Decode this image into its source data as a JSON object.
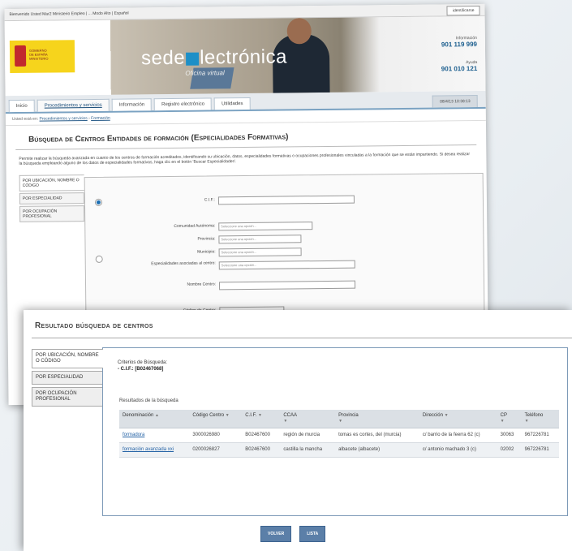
{
  "back": {
    "topbar": "Bienvenido Usted Mar2 Ministerio Empleo | ... Modo Alto | Español",
    "account": "identificarse",
    "logo_left": "sede",
    "logo_right": "lectrónica",
    "logo_sub": "Oficina virtual",
    "phone1_label": "Información",
    "phone1": "901 119 999",
    "phone2_label": "Ayuda",
    "phone2": "901 010 121",
    "nav": [
      "Inicio",
      "Procedimientos y servicios",
      "Información",
      "Registro electrónico",
      "Utilidades"
    ],
    "nav_date": "08/4/13   10:38:13",
    "crumb_prefix": "Usted está en:",
    "crumb_links": [
      "Procedimientos y servicios",
      "Formación"
    ],
    "title": "Búsqueda de Centros Entidades de formación (Especialidades Formativas)",
    "intro": "Permite realizar la búsqueda avanzada en cuanto de los centros de formación acreditados, identificando su ubicación, datos, especialidades formativas o ocupaciones profesionales vinculadas a la formación que se están impartiendo. Si desea realizar la búsqueda empleando alguno de los datos de especialidades formativas, haga clic en el botón 'Buscar Especialidades'.",
    "tabs": [
      "POR UBICACIÓN, NOMBRE O CÓDIGO",
      "POR ESPECIALIDAD",
      "POR OCUPACIÓN PROFESIONAL"
    ],
    "form": {
      "cif_label": "C.I.F.:",
      "ccaa_label": "Comunidad Autónoma:",
      "prov_label": "Provincia:",
      "muni_label": "Municipio:",
      "esp_label": "Especialidades asociadas al centro:",
      "nombre_label": "Nombre Centro:",
      "codigo_label": "Código de Centro:",
      "select_placeholder": "Seleccione una opción..."
    }
  },
  "front": {
    "title": "Resultado búsqueda de centros",
    "tabs": [
      "POR UBICACIÓN, NOMBRE O CÓDIGO",
      "POR ESPECIALIDAD",
      "POR OCUPACIÓN PROFESIONAL"
    ],
    "criteria_title": "Criterios de Búsqueda:",
    "criteria_value": "- C.I.F.: [B02467068]",
    "results_label": "Resultados de la búsqueda",
    "columns": [
      "Denominación",
      "Código Centro",
      "C.I.F.",
      "CCAA",
      "Provincia",
      "Dirección",
      "CP",
      "Teléfono"
    ],
    "rows": [
      [
        "formadora",
        "3000026980",
        "B02467600",
        "región de murcia",
        "tomas es cortes, del (murcia)",
        "c/ barrio de la feerra 62 (c)",
        "30063",
        "967226781"
      ],
      [
        "formación avanzada xxi",
        "0200026827",
        "B02467600",
        "castilla la mancha",
        "albacete (albacete)",
        "c/ antonio machado 3 (c)",
        "02002",
        "967226781"
      ]
    ],
    "buttons": [
      "Volver",
      "Lista"
    ]
  }
}
